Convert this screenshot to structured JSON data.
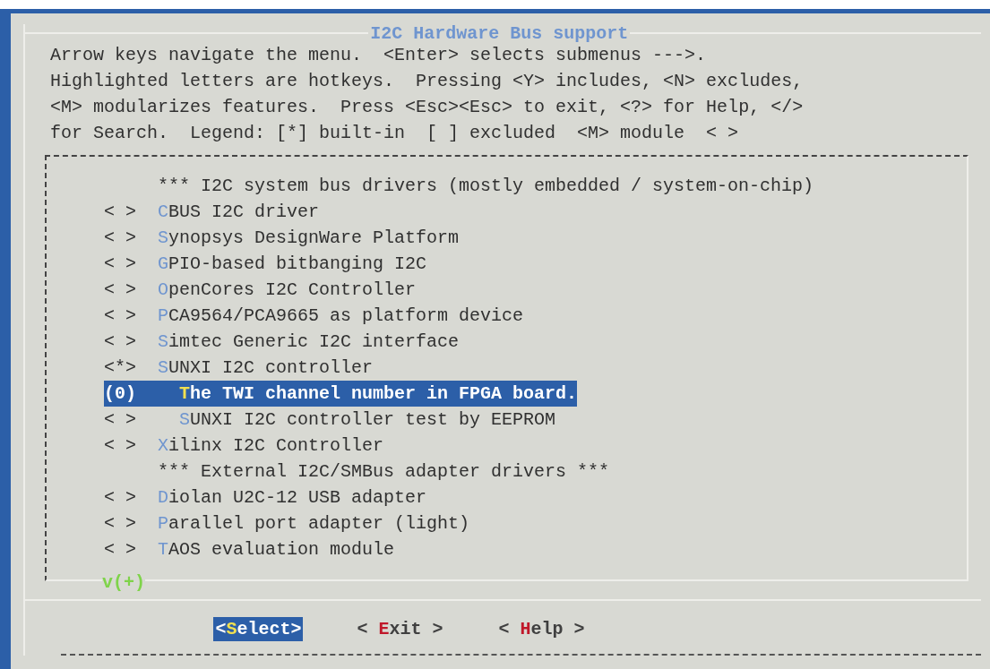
{
  "dialog": {
    "title": "I2C Hardware Bus support",
    "help_lines": [
      "Arrow keys navigate the menu.  <Enter> selects submenus --->.",
      "Highlighted letters are hotkeys.  Pressing <Y> includes, <N> excludes,",
      "<M> modularizes features.  Press <Esc><Esc> to exit, <?> for Help, </>",
      "for Search.  Legend: [*] built-in  [ ] excluded  <M> module  < >"
    ],
    "items": [
      {
        "kind": "comment",
        "label": "*** I2C system bus drivers (mostly embedded / system-on-chip)"
      },
      {
        "kind": "option",
        "value": "< >",
        "label": "CBUS I2C driver",
        "selected": false
      },
      {
        "kind": "option",
        "value": "< >",
        "label": "Synopsys DesignWare Platform",
        "selected": false
      },
      {
        "kind": "option",
        "value": "< >",
        "label": "GPIO-based bitbanging I2C",
        "selected": false
      },
      {
        "kind": "option",
        "value": "< >",
        "label": "OpenCores I2C Controller",
        "selected": false
      },
      {
        "kind": "option",
        "value": "< >",
        "label": "PCA9564/PCA9665 as platform device",
        "selected": false
      },
      {
        "kind": "option",
        "value": "< >",
        "label": "Simtec Generic I2C interface",
        "selected": false
      },
      {
        "kind": "option",
        "value": "<*>",
        "label": "SUNXI I2C controller",
        "selected": false,
        "children": [
          {
            "kind": "option",
            "value": "(0)",
            "label": "The TWI channel number in FPGA board.",
            "selected": true
          },
          {
            "kind": "option",
            "value": "< >",
            "label": "SUNXI I2C controller test by EEPROM",
            "selected": false
          }
        ]
      },
      {
        "kind": "option",
        "value": "< >",
        "label": "Xilinx I2C Controller",
        "selected": false
      },
      {
        "kind": "comment",
        "label": "*** External I2C/SMBus adapter drivers ***"
      },
      {
        "kind": "option",
        "value": "< >",
        "label": "Diolan U2C-12 USB adapter",
        "selected": false
      },
      {
        "kind": "option",
        "value": "< >",
        "label": "Parallel port adapter (light)",
        "selected": false
      },
      {
        "kind": "option",
        "value": "< >",
        "label": "TAOS evaluation module",
        "selected": false
      }
    ],
    "scroll_indicator": "v(+)",
    "buttons": [
      {
        "text": "<Select>",
        "selected": true
      },
      {
        "text": "< Exit >",
        "selected": false
      },
      {
        "text": "< Help >",
        "selected": false
      }
    ]
  }
}
